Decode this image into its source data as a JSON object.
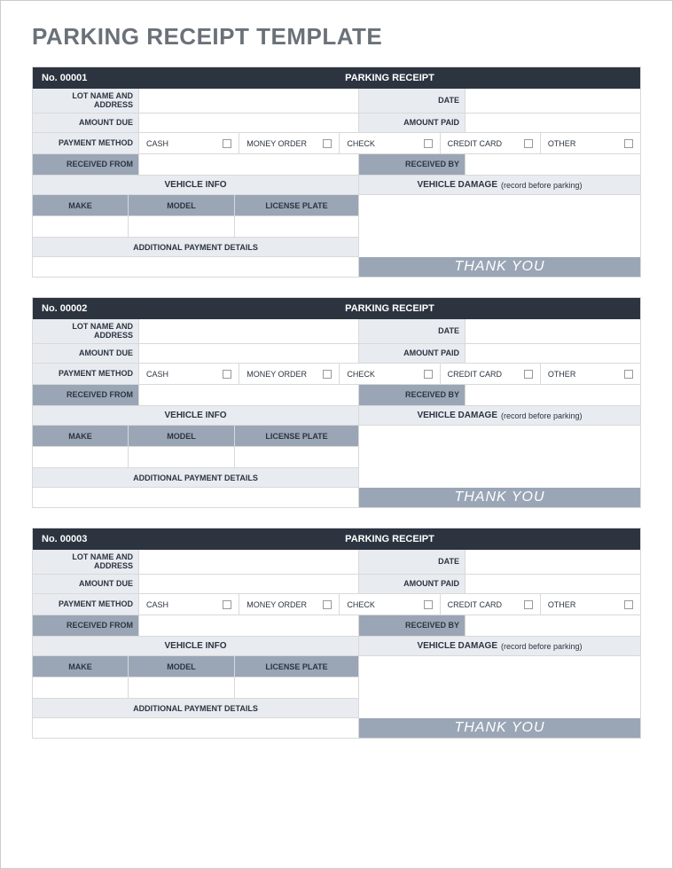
{
  "pageTitle": "PARKING RECEIPT TEMPLATE",
  "labels": {
    "lotName": "LOT NAME AND ADDRESS",
    "date": "DATE",
    "amountDue": "AMOUNT DUE",
    "amountPaid": "AMOUNT PAID",
    "paymentMethod": "PAYMENT METHOD",
    "receivedFrom": "RECEIVED FROM",
    "receivedBy": "RECEIVED BY",
    "vehicleInfo": "VEHICLE INFO",
    "vehicleDamage": "VEHICLE DAMAGE",
    "vehicleDamageNote": "(record before parking)",
    "make": "MAKE",
    "model": "MODEL",
    "licensePlate": "LICENSE PLATE",
    "additionalPayment": "ADDITIONAL PAYMENT DETAILS",
    "thankYou": "THANK YOU",
    "receiptTitle": "PARKING RECEIPT"
  },
  "paymentOptions": [
    "CASH",
    "MONEY ORDER",
    "CHECK",
    "CREDIT CARD",
    "OTHER"
  ],
  "receipts": [
    {
      "number": "No. 00001"
    },
    {
      "number": "No. 00002"
    },
    {
      "number": "No. 00003"
    }
  ]
}
